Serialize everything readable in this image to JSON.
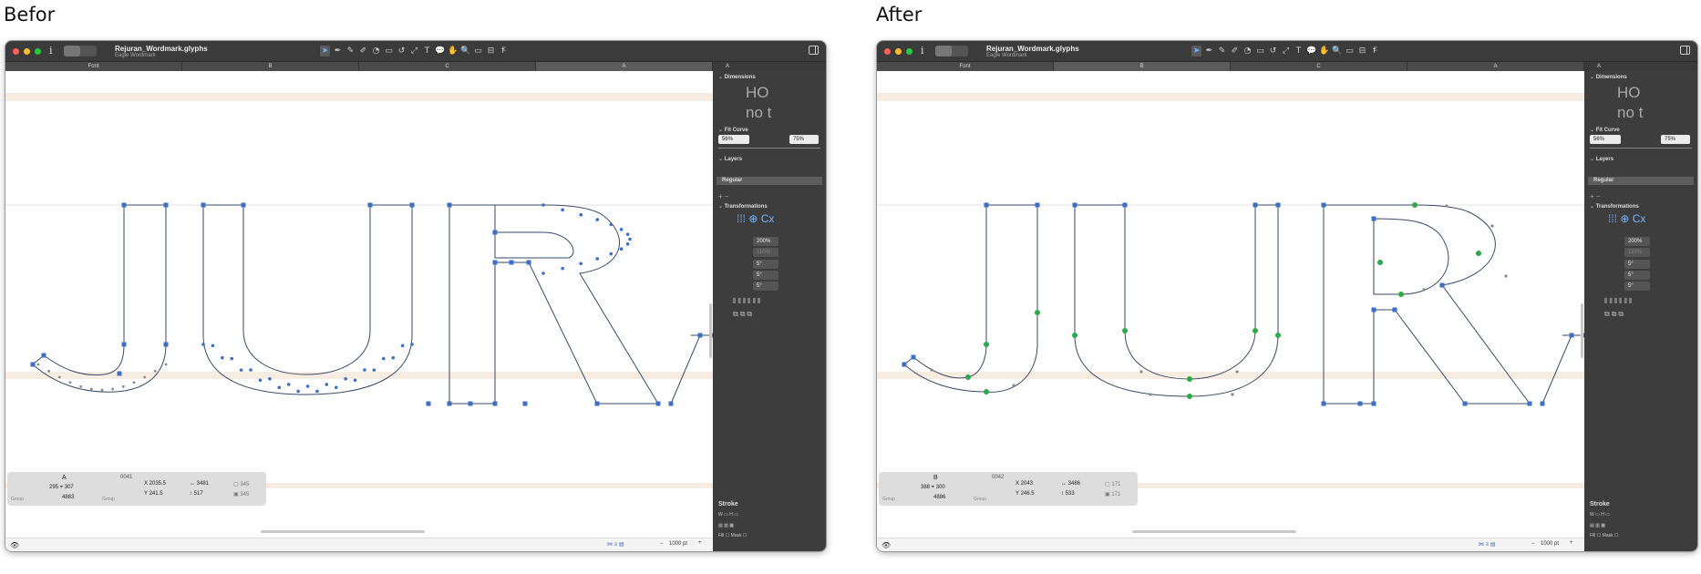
{
  "captions": {
    "before": "Befor",
    "after": "After"
  },
  "window": {
    "doc_name": "Rejuran_Wordmark.glyphs",
    "doc_subtitle": "Eagle Wordmark",
    "tool_icons": [
      "select-tool-icon",
      "pen-tool-icon",
      "pencil-tool-icon",
      "brush-tool-icon",
      "shape-tool-icon",
      "rectangle-tool-icon",
      "rotate-tool-icon",
      "scale-tool-icon",
      "text-tool-icon",
      "annotation-tool-icon",
      "hand-tool-icon",
      "zoom-tool-icon",
      "measure-tool-icon",
      "knife-tool-icon",
      "sample-text-icon"
    ],
    "tool_glyphs": [
      "➤",
      "✒",
      "✎",
      "✐",
      "◔",
      "▭",
      "↺",
      "⤢",
      "T",
      "💬",
      "✋",
      "🔍",
      "▭",
      "⊟",
      "Ꞙ"
    ]
  },
  "tabs": [
    "Font",
    "B",
    "C",
    "A"
  ],
  "panel": {
    "dimensions_label": "Dimensions",
    "dim_text_top": "HO",
    "dim_text_bottom": "no t",
    "fit_curve_label": "Fit Curve",
    "fit_left": "56%",
    "fit_right": "75%",
    "layers_label": "Layers",
    "layer_name": "Regular",
    "transformations_label": "Transformations",
    "scale_value": "200%",
    "scale_value_2": "110%",
    "rotate_value": "5°",
    "slant_value": "5°",
    "skew_value": "5°",
    "stroke_label": "Stroke",
    "stroke_w": "W",
    "stroke_h": "H",
    "fill_label": "Fill",
    "mask_label": "Mask"
  },
  "before": {
    "active_tab": "A",
    "info": {
      "glyph": "A",
      "code": "0041",
      "w_left": "295",
      "w_right": "307",
      "width": "4883",
      "x": "2035.5",
      "y": "241.5",
      "w": "3481",
      "h": "517",
      "n1": "345",
      "n2": "345",
      "group": "Group"
    }
  },
  "after": {
    "active_tab": "B",
    "info": {
      "glyph": "B",
      "code": "0042",
      "w_left": "388",
      "w_right": "300",
      "width": "4886",
      "x": "2043",
      "y": "246.5",
      "w": "3486",
      "h": "533",
      "n1": "171",
      "n2": "171",
      "group": "Group"
    }
  },
  "status": {
    "zoom": "1000 pt"
  },
  "colors": {
    "node": "#3d6fc4",
    "smooth_node": "#2ea84a",
    "path": "#3a4a6a",
    "handle": "#888888",
    "metric_band": "#f7ece2",
    "panel": "#3d3d3d",
    "titlebar": "#3b3b3b"
  }
}
